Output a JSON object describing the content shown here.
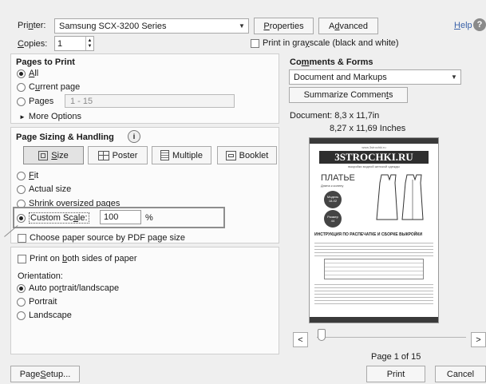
{
  "printer": {
    "label_pre": "Pri",
    "label_u": "n",
    "label_post": "ter:",
    "value": "Samsung SCX-3200 Series"
  },
  "properties_button": {
    "pre": "",
    "u": "P",
    "post": "roperties"
  },
  "advanced_button": {
    "pre": "A",
    "u": "d",
    "post": "vanced"
  },
  "help_link": {
    "pre": "",
    "u": "H",
    "post": "elp"
  },
  "copies": {
    "pre": "",
    "u": "C",
    "post": "opies:",
    "value": "1"
  },
  "grayscale": {
    "pre": "Print in gra",
    "u": "y",
    "post": "scale (black and white)"
  },
  "pages_to_print": {
    "title": "Pages to Print",
    "all": {
      "pre": "",
      "u": "A",
      "post": "ll"
    },
    "current": {
      "pre": "C",
      "u": "u",
      "post": "rrent page"
    },
    "pages": {
      "pre": "Pa",
      "u": "g",
      "post": "es"
    },
    "pages_value": "1 - 15",
    "more": "More Options"
  },
  "page_sizing": {
    "title": "Page Sizing & Handling",
    "tabs": {
      "size": {
        "pre": "",
        "u": "S",
        "post": "ize"
      },
      "poster": "Poster",
      "multiple": "Multiple",
      "booklet": "Booklet"
    },
    "fit": {
      "pre": "",
      "u": "F",
      "post": "it"
    },
    "actual": "Actual size",
    "shrink": "Shrink oversized pages",
    "custom": {
      "pre": "Custom Sc",
      "u": "a",
      "post": "le:"
    },
    "custom_value": "100",
    "percent": "%",
    "paper_source": "Choose paper source by PDF page size"
  },
  "both_sides": {
    "pre": "Print on ",
    "u": "b",
    "post": "oth sides of paper"
  },
  "orientation": {
    "title": "Orientation:",
    "auto": {
      "pre": "Auto po",
      "u": "r",
      "post": "trait/landscape"
    },
    "portrait": "Portrait",
    "landscape": "Landscape"
  },
  "comments_forms": {
    "title_pre": "Co",
    "title_u": "m",
    "title_post": "ments & Forms",
    "value": "Document and Markups",
    "summarize_pre": "Summarize Commen",
    "summarize_u": "t",
    "summarize_post": "s"
  },
  "document_info": "Document: 8,3 x 11,7in",
  "paper_size": "8,27 x 11,69 Inches",
  "preview_doc": {
    "site": "www.3strochki.ru",
    "logo": "3STROCHKI.RU",
    "tagline": "выкройки модной женской одежды",
    "title": "ПЛАТЬЕ",
    "subtitle": "Длина к колену",
    "badge1_line1": "Модель",
    "badge1_line2": "18-02",
    "badge2_line1": "Размер",
    "badge2_line2": "44",
    "heading": "ИНСТРУКЦИЯ ПО РАСПЕЧАТКЕ И СБОРКЕ ВЫКРОЙКИ"
  },
  "page_counter": "Page 1 of 15",
  "page_setup_button": {
    "pre": "Page ",
    "u": "S",
    "post": "etup..."
  },
  "print_button": "Print",
  "cancel_button": "Cancel",
  "nav": {
    "prev": "<",
    "next": ">"
  },
  "info_icon_text": "i"
}
